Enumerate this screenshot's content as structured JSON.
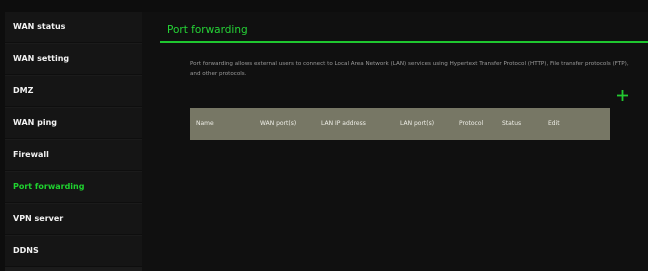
{
  "sidebar": {
    "items": [
      {
        "label": "WAN status"
      },
      {
        "label": "WAN setting"
      },
      {
        "label": "DMZ"
      },
      {
        "label": "WAN ping"
      },
      {
        "label": "Firewall"
      },
      {
        "label": "Port forwarding",
        "active": true
      },
      {
        "label": "VPN server"
      },
      {
        "label": "DDNS"
      }
    ]
  },
  "main": {
    "title": "Port forwarding",
    "description": "Port forwarding allows external users to connect to Local Area Network (LAN) services using Hypertext Transfer Protocol (HTTP), File transfer protocols (FTP), and other protocols.",
    "add_icon": "plus-icon",
    "table": {
      "headers": [
        "Name",
        "WAN port(s)",
        "LAN IP address",
        "LAN port(s)",
        "Protocol",
        "Status",
        "Edit"
      ]
    }
  },
  "colors": {
    "accent": "#1fd22f",
    "background": "#0d0d0d",
    "sidebar_bg": "#151515",
    "table_header_bg": "#777765"
  }
}
